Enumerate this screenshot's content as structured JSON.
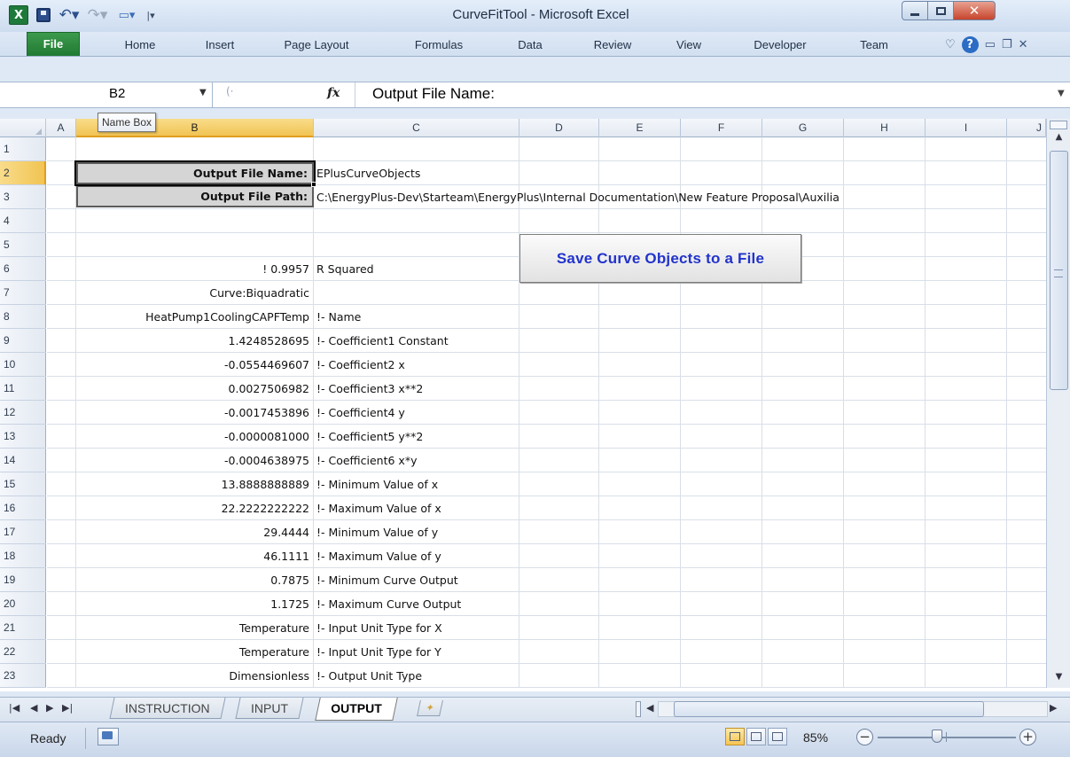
{
  "window": {
    "title": "CurveFitTool - Microsoft Excel",
    "app_logo": "X"
  },
  "icons": {
    "qat": [
      "excel-logo-icon",
      "save-icon",
      "undo-icon",
      "redo-icon",
      "qat-extra-icon",
      "qat-customize-icon"
    ],
    "window_controls": [
      "minimize-icon",
      "maximize-icon",
      "close-icon"
    ]
  },
  "ribbon": {
    "tabs": [
      "File",
      "Home",
      "Insert",
      "Page Layout",
      "Formulas",
      "Data",
      "Review",
      "View",
      "Developer",
      "Team"
    ],
    "active_color": "#217a33"
  },
  "formula_bar": {
    "name_box": "B2",
    "fx_label": "fx",
    "value": "Output File Name:"
  },
  "tooltip": {
    "text": "Name Box"
  },
  "grid": {
    "columns": [
      "A",
      "B",
      "C",
      "D",
      "E",
      "F",
      "G",
      "H",
      "I",
      "J"
    ],
    "rows": [
      "1",
      "2",
      "3",
      "4",
      "5",
      "6",
      "7",
      "8",
      "9",
      "10",
      "11",
      "12",
      "13",
      "14",
      "15",
      "16",
      "17",
      "18",
      "19",
      "20",
      "21",
      "22",
      "23"
    ],
    "selected_cell": "B2",
    "labels": {
      "output_file_name_label": "Output File Name:",
      "output_file_name_value": "EPlusCurveObjects",
      "output_file_path_label": "Output File Path:",
      "output_file_path_value": "C:\\EnergyPlus-Dev\\Starteam\\EnergyPlus\\Internal Documentation\\New Feature Proposal\\Auxilia"
    },
    "data_rows": [
      {
        "row": 6,
        "b": "! 0.9957",
        "c": "R Squared"
      },
      {
        "row": 7,
        "b": "Curve:Biquadratic",
        "c": ""
      },
      {
        "row": 8,
        "b": "HeatPump1CoolingCAPFTemp",
        "c": "!- Name"
      },
      {
        "row": 9,
        "b": "1.4248528695",
        "c": "!- Coefficient1 Constant"
      },
      {
        "row": 10,
        "b": "-0.0554469607",
        "c": "!- Coefficient2 x"
      },
      {
        "row": 11,
        "b": "0.0027506982",
        "c": "!- Coefficient3 x**2"
      },
      {
        "row": 12,
        "b": "-0.0017453896",
        "c": "!- Coefficient4 y"
      },
      {
        "row": 13,
        "b": "-0.0000081000",
        "c": "!- Coefficient5 y**2"
      },
      {
        "row": 14,
        "b": "-0.0004638975",
        "c": "!- Coefficient6 x*y"
      },
      {
        "row": 15,
        "b": "13.8888888889",
        "c": "!- Minimum Value of x"
      },
      {
        "row": 16,
        "b": "22.2222222222",
        "c": "!- Maximum Value of x"
      },
      {
        "row": 17,
        "b": "29.4444",
        "c": "!- Minimum Value of y"
      },
      {
        "row": 18,
        "b": "46.1111",
        "c": "!- Maximum Value of y"
      },
      {
        "row": 19,
        "b": "0.7875",
        "c": "!- Minimum Curve Output"
      },
      {
        "row": 20,
        "b": "1.1725",
        "c": "!- Maximum Curve Output"
      },
      {
        "row": 21,
        "b": "Temperature",
        "c": "!- Input Unit Type for X"
      },
      {
        "row": 22,
        "b": "Temperature",
        "c": "!- Input Unit Type for Y"
      },
      {
        "row": 23,
        "b": "Dimensionless",
        "c": "!- Output Unit Type"
      }
    ],
    "button_label": "Save Curve Objects to a File",
    "button_color": "#2233cc"
  },
  "sheets": {
    "tabs": [
      "INSTRUCTION",
      "INPUT",
      "OUTPUT"
    ],
    "active": "OUTPUT"
  },
  "status_bar": {
    "status": "Ready",
    "zoom": "85%",
    "zoom_out": "−",
    "zoom_in": "+"
  }
}
